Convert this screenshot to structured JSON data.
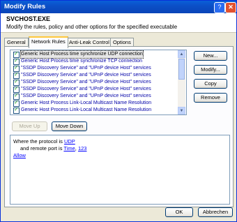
{
  "window": {
    "title": "Modify Rules",
    "help_glyph": "?",
    "close_glyph": "✕"
  },
  "header": {
    "title": "SVCHOST.EXE",
    "subtitle": "Modify the rules, policy and other options for the specified executable"
  },
  "tabs": [
    {
      "label": "General",
      "active": false
    },
    {
      "label": "Network Rules",
      "active": true
    },
    {
      "label": "Anti-Leak Control",
      "active": false
    },
    {
      "label": "Options",
      "active": false
    }
  ],
  "rules": [
    {
      "label": "Generic Host Process time synchronize UDP connection",
      "checked": true,
      "selected": true
    },
    {
      "label": "Generic Host Process time synchronize TCP connection",
      "checked": true,
      "selected": false
    },
    {
      "label": "\"SSDP Discovery Service\" and \"UPnP device Host\" services",
      "checked": true,
      "selected": false
    },
    {
      "label": "\"SSDP Discovery Service\" and \"UPnP device Host\" services",
      "checked": true,
      "selected": false
    },
    {
      "label": "\"SSDP Discovery Service\" and \"UPnP device Host\" services",
      "checked": true,
      "selected": false
    },
    {
      "label": "\"SSDP Discovery Service\" and \"UPnP device Host\" services",
      "checked": true,
      "selected": false
    },
    {
      "label": "\"SSDP Discovery Service\" and \"UPnP device Host\" services",
      "checked": true,
      "selected": false
    },
    {
      "label": "Generic Host Process Link-Local Multicast Name Resolution",
      "checked": true,
      "selected": false
    },
    {
      "label": "Generic Host Process Link-Local Multicast Name Resolution",
      "checked": true,
      "selected": false
    }
  ],
  "scroll": {
    "up_glyph": "▲",
    "down_glyph": "▼"
  },
  "buttons": {
    "new": "New...",
    "modify": "Modify...",
    "copy": "Copy",
    "remove": "Remove",
    "move_up": "Move Up",
    "move_down": "Move Down",
    "ok": "OK",
    "cancel": "Abbrechen"
  },
  "description": {
    "line1_prefix": "Where the protocol is ",
    "protocol": "UDP",
    "line2_prefix": "and remote port is ",
    "port_link1": "Time",
    "port_sep": ", ",
    "port_link2": "123",
    "action": "Allow"
  }
}
